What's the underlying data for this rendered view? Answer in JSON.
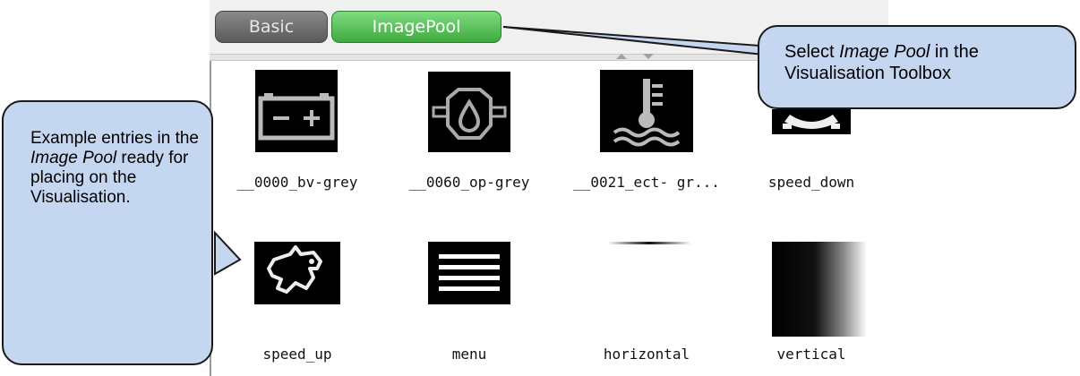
{
  "tabs": [
    {
      "label": "Basic"
    },
    {
      "label": "ImagePool"
    }
  ],
  "images": [
    {
      "name": "__0000_bv-grey",
      "icon": "battery-icon"
    },
    {
      "name": "__0060_op-grey",
      "icon": "oil-pressure-icon"
    },
    {
      "name": "__0021_ect- gr...",
      "icon": "coolant-temperature-icon"
    },
    {
      "name": "speed_down",
      "icon": "turtle-icon"
    },
    {
      "name": "speed_up",
      "icon": "rabbit-icon"
    },
    {
      "name": "menu",
      "icon": "menu-icon"
    },
    {
      "name": "horizontal",
      "icon": "horizontal-line-icon"
    },
    {
      "name": "vertical",
      "icon": "vertical-gradient-icon"
    }
  ],
  "callouts": {
    "top": {
      "prefix": "Select ",
      "emphasis": "Image Pool",
      "suffix": " in the Visualisation Toolbox"
    },
    "left": {
      "prefix": "Example entries in the ",
      "emphasis": "Image Pool",
      "suffix": " ready for placing on the Visualisation."
    }
  },
  "colors": {
    "callout_fill": "#c5d7f0",
    "tab_active": "#4cbc4c",
    "tab_inactive": "#6e6e6e"
  }
}
